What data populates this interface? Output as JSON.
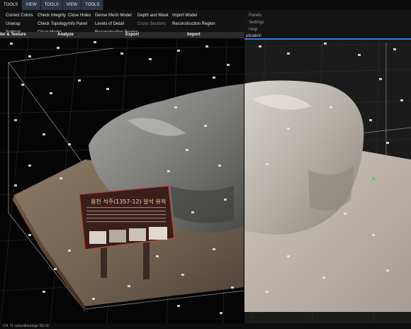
{
  "menubar": {
    "tabs": [
      {
        "label": "TOOLS",
        "active": true
      },
      {
        "label": "VIEW",
        "active": false
      },
      {
        "label": "TOOLS",
        "active": false
      },
      {
        "label": "VIEW",
        "active": false
      },
      {
        "label": "TOOLS",
        "active": false
      }
    ]
  },
  "ribbon": {
    "colour_texture": [
      "Correct Colors",
      "Unwrap",
      "Settings"
    ],
    "analyze_a": [
      "Check Integrity",
      "Check Topology",
      "Clean Model"
    ],
    "analyze_b": [
      "Close Holes",
      "Info Panel"
    ],
    "export_a": [
      "Dense Mesh Model",
      "Levels of Detail",
      "Reconstruction Region"
    ],
    "export_b": [
      "Depth and Mask",
      "Cross Sections"
    ],
    "import": [
      "Import Model",
      "Reconstruction Region"
    ],
    "groups": {
      "colour_texture": "lor & Texture",
      "analyze": "Analyze",
      "export": "Export",
      "import": "Import"
    }
  },
  "right_panel": {
    "items": [
      "Panels",
      "Settings",
      "Help"
    ],
    "application": "plication"
  },
  "sign": {
    "title": "용천 석주(1357-12) 알석 유적"
  },
  "status": {
    "text": "CH. 이 culturalheritage 테스트"
  },
  "colors": {
    "menubar_tab": "#2c3846",
    "accent_blue": "#2d7ad6",
    "ground": "#8a7764",
    "rock_textured": "#8d8d8d",
    "rock_shaded": "#bdb8b2",
    "sign_board": "#3a1e1a"
  }
}
